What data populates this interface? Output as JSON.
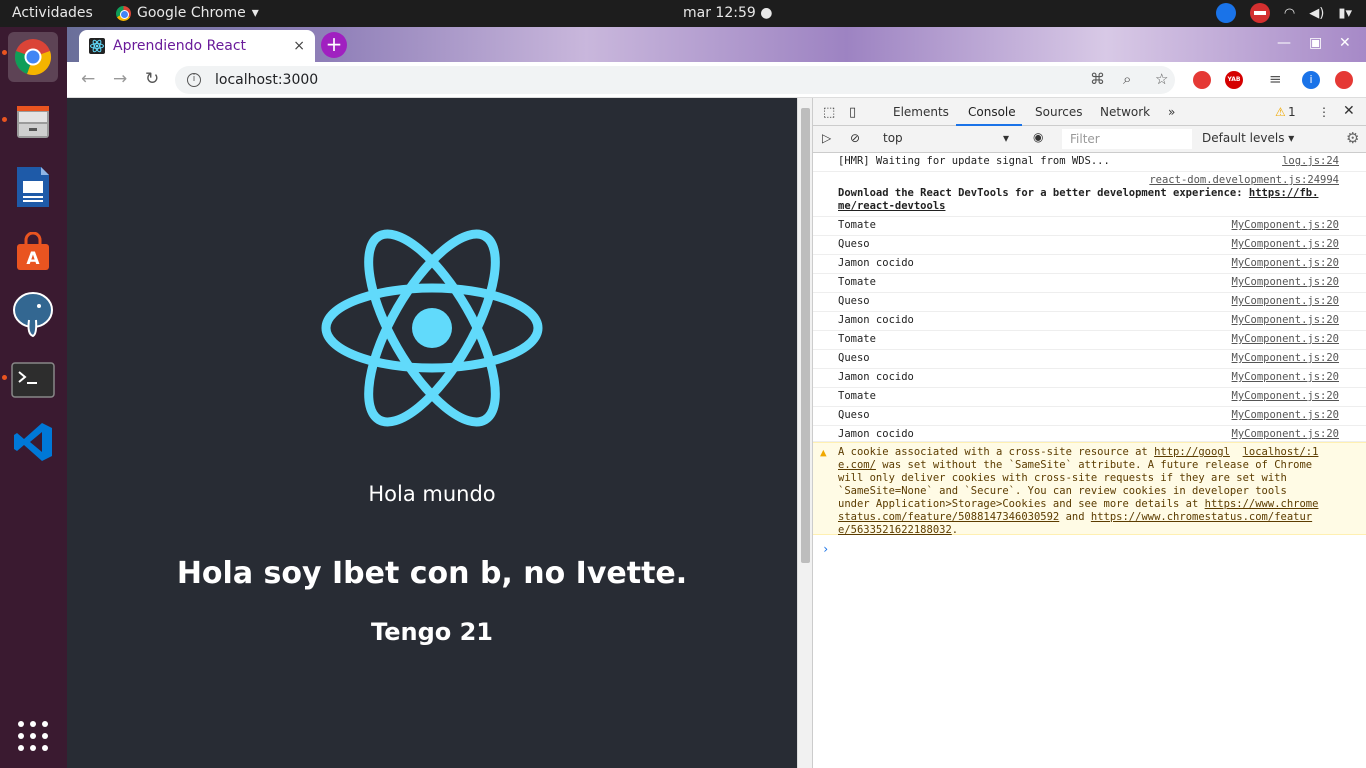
{
  "topbar": {
    "activities": "Actividades",
    "app_name": "Google Chrome",
    "app_arrow": "▾",
    "clock": "mar 12:59 ●"
  },
  "browser": {
    "tab_title": "Aprendiendo React",
    "tab_close": "×",
    "new_tab": "+",
    "url": "localhost:3000",
    "ext_labels": {
      "yab": "YAB",
      "i": "i"
    }
  },
  "page": {
    "greeting": "Hola mundo",
    "heading": "Hola soy Ibet con b, no Ivette.",
    "age": "Tengo 21"
  },
  "devtools": {
    "tabs": [
      "Elements",
      "Console",
      "Sources",
      "Network"
    ],
    "more": "»",
    "warning_count": "1",
    "context": "top",
    "filter_placeholder": "Filter",
    "levels": "Default levels ▾",
    "logs": [
      {
        "msg": "[HMR] Waiting for update signal from WDS...",
        "src": "log.js:24"
      },
      {
        "msg": "Tomate",
        "src": "MyComponent.js:20"
      },
      {
        "msg": "Queso",
        "src": "MyComponent.js:20"
      },
      {
        "msg": "Jamon cocido",
        "src": "MyComponent.js:20"
      },
      {
        "msg": "Tomate",
        "src": "MyComponent.js:20"
      },
      {
        "msg": "Queso",
        "src": "MyComponent.js:20"
      },
      {
        "msg": "Jamon cocido",
        "src": "MyComponent.js:20"
      },
      {
        "msg": "Tomate",
        "src": "MyComponent.js:20"
      },
      {
        "msg": "Queso",
        "src": "MyComponent.js:20"
      },
      {
        "msg": "Jamon cocido",
        "src": "MyComponent.js:20"
      },
      {
        "msg": "Tomate",
        "src": "MyComponent.js:20"
      },
      {
        "msg": "Queso",
        "src": "MyComponent.js:20"
      },
      {
        "msg": "Jamon cocido",
        "src": "MyComponent.js:20"
      }
    ],
    "react_devtools": {
      "src": "react-dom.development.js:24994",
      "line1": "Download the React DevTools for a better development experience: ",
      "link1": "https://fb.",
      "link2": "me/react-devtools"
    },
    "warning": {
      "l1a": "A cookie associated with a cross-site resource at ",
      "l1b": "http://googl",
      "l1c": "localhost/:1",
      "l2a": "e.com/",
      "l2b": " was set without the `SameSite` attribute. A future release of Chrome",
      "l3": "will only deliver cookies with cross-site requests if they are set with",
      "l4": "`SameSite=None` and `Secure`. You can review cookies in developer tools",
      "l5a": "under Application>Storage>Cookies and see more details at ",
      "l5b": "https://www.chrome",
      "l6a": "status.com/feature/5088147346030592",
      "l6b": " and ",
      "l6c": "https://www.chromestatus.com/featur",
      "l7": "e/5633521622188032",
      "l7b": "."
    },
    "prompt": "›"
  }
}
